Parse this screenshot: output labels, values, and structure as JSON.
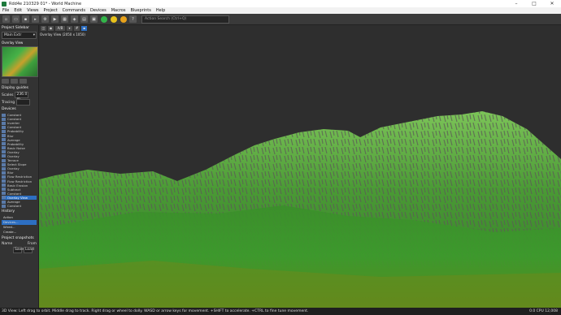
{
  "window": {
    "title": "Rdd4e 210329 01* - World Machine"
  },
  "menu": [
    "File",
    "Edit",
    "Views",
    "Project",
    "Commands",
    "Devices",
    "Macros",
    "Blueprints",
    "Help"
  ],
  "toolbar": {
    "search_placeholder": "Action Search (Ctrl+Q)"
  },
  "sidebar": {
    "title": "Project Sidebar",
    "world_select": "Main Extr",
    "overlay_label": "Overlay View",
    "display_guides": "Display guides",
    "scales_label": "Scales",
    "scales_value": "236.0 m",
    "tracing_label": "Tracing",
    "devices_title": "Devices",
    "devices": [
      "Constant",
      "Constant",
      "Inverter",
      "Constant",
      "Probability",
      "Blur",
      "Average",
      "Probability",
      "Basic Noise",
      "Overlay",
      "Overlay",
      "Terrace",
      "Select Slope",
      "Overlay",
      "Blur",
      "Flow Restriction",
      "Flow Restriction",
      "Basic Erosion",
      "Subtract",
      "Constant",
      "Overlay View",
      "Average",
      "Constant"
    ],
    "active_device_index": 20,
    "history_title": "History",
    "history_col_action": "Action",
    "history_rows": [
      "Devices...",
      "Wired...",
      "Create..."
    ],
    "snapshots_title": "Project snapshots",
    "snap_name_label": "Name",
    "snap_from_label": "From",
    "snap_save": "Save",
    "snap_load": "Load"
  },
  "viewport": {
    "mode_label": "A/B",
    "view_label": "Overlay View (2050 x 1050)"
  },
  "status": {
    "left": "3D View: Left drag to orbit. Middle drag to track. Right drag or wheel to dolly. WASD or arrow keys for movement. +SHIFT to accelerate. +CTRL to fine tune movement.",
    "right": "0.0 CPU 12,008"
  }
}
